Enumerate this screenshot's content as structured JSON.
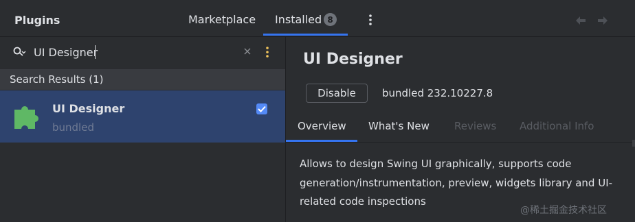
{
  "header": {
    "title": "Plugins",
    "tabs": {
      "marketplace": "Marketplace",
      "installed": "Installed",
      "installed_count": "8"
    },
    "icons": [
      "more-vertical-icon",
      "back-arrow-icon",
      "forward-arrow-icon"
    ]
  },
  "search": {
    "value": "UI Designer",
    "icons": [
      "search-icon",
      "clear-icon",
      "filter-icon"
    ]
  },
  "results": {
    "header": "Search Results (1)",
    "items": [
      {
        "name": "UI Designer",
        "subtitle": "bundled",
        "enabled": true,
        "icon": "plugin-puzzle-icon"
      }
    ]
  },
  "detail": {
    "title": "UI Designer",
    "disable_label": "Disable",
    "version": "bundled 232.10227.8",
    "tabs": {
      "overview": "Overview",
      "whats_new": "What's New",
      "reviews": "Reviews",
      "additional_info": "Additional Info"
    },
    "description": "Allows to design Swing UI graphically, supports code generation/instrumentation, preview, widgets library and UI-related code inspections"
  },
  "watermark": "@稀土掘金技术社区",
  "colors": {
    "background": "#2b2d30",
    "accent": "#3574f0",
    "selection": "#2e436e",
    "plugin_icon": "#5fb865",
    "filter_dots": "#f2c55c"
  }
}
